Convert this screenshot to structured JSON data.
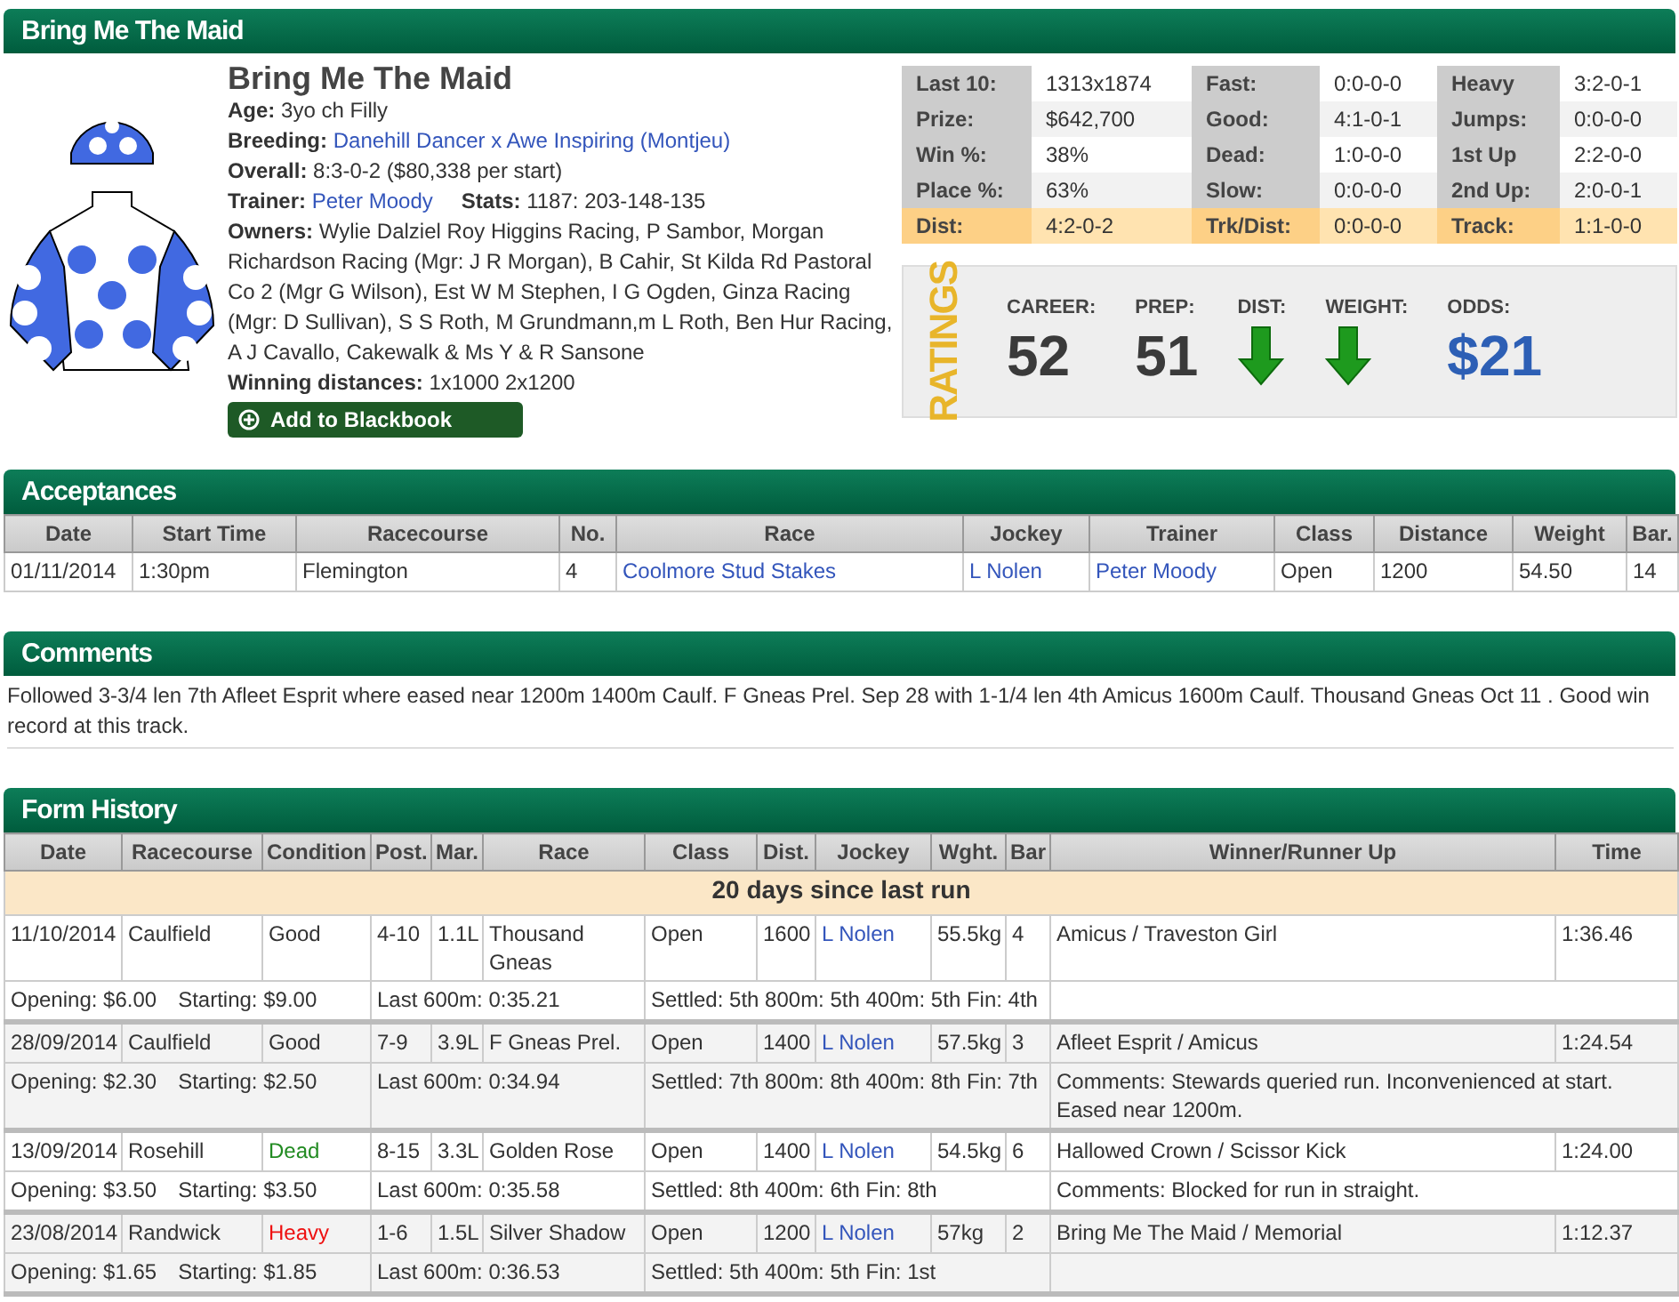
{
  "profile": {
    "header": "Bring Me The Maid",
    "name": "Bring Me The Maid",
    "lines": [
      {
        "parts": [
          {
            "label": "Age:",
            "value": "3yo ch Filly",
            "link": false
          }
        ]
      },
      {
        "parts": [
          {
            "label": "Breeding:",
            "value": "Danehill Dancer x Awe Inspiring (Montjeu)",
            "link": true
          }
        ]
      },
      {
        "parts": [
          {
            "label": "Overall:",
            "value": "8:3-0-2 ($80,338 per start)",
            "link": false
          }
        ]
      },
      {
        "parts": [
          {
            "label": "Trainer:",
            "value": "Peter Moody",
            "link": true
          },
          {
            "label": "Stats:",
            "value": "1187: 203-148-135",
            "link": false
          }
        ]
      },
      {
        "parts": [
          {
            "label": "Owners:",
            "value": "Wylie Dalziel Roy Higgins Racing, P Sambor, Morgan Richardson Racing (Mgr: J R Morgan), B Cahir, St Kilda Rd Pastoral Co 2 (Mgr G Wilson), Est W M Stephen, I G Ogden, Ginza Racing (Mgr: D Sullivan), S S Roth, M Grundmann,m L Roth, Ben Hur Racing, A J Cavallo, Cakewalk & Ms Y & R Sansone",
            "link": false
          }
        ]
      },
      {
        "parts": [
          {
            "label": "Winning distances:",
            "value": "1x1000 2x1200",
            "link": false
          }
        ]
      }
    ],
    "button": "Add to Blackbook"
  },
  "stats": [
    {
      "highlighted": false,
      "cells": [
        "Last 10:",
        "1313x1874",
        "Fast:",
        "0:0-0-0",
        "Heavy",
        "3:2-0-1"
      ]
    },
    {
      "highlighted": false,
      "cells": [
        "Prize:",
        "$642,700",
        "Good:",
        "4:1-0-1",
        "Jumps:",
        "0:0-0-0"
      ]
    },
    {
      "highlighted": false,
      "cells": [
        "Win %:",
        "38%",
        "Dead:",
        "1:0-0-0",
        "1st Up",
        "2:2-0-0"
      ]
    },
    {
      "highlighted": false,
      "cells": [
        "Place %:",
        "63%",
        "Slow:",
        "0:0-0-0",
        "2nd Up:",
        "2:0-0-1"
      ]
    },
    {
      "highlighted": true,
      "cells": [
        "Dist:",
        "4:2-0-2",
        "Trk/Dist:",
        "0:0-0-0",
        "Track:",
        "1:1-0-0"
      ]
    }
  ],
  "ratings": {
    "title": "RATINGS",
    "items": [
      {
        "kind": "number",
        "label": "CAREER:",
        "value": "52"
      },
      {
        "kind": "number",
        "label": "PREP:",
        "value": "51"
      },
      {
        "kind": "arrow",
        "label": "DIST:",
        "down": true
      },
      {
        "kind": "arrow",
        "label": "WEIGHT:",
        "down": true
      },
      {
        "kind": "odds",
        "label": "ODDS:",
        "value": "$21"
      }
    ]
  },
  "acceptances": {
    "title": "Acceptances",
    "columns": [
      "Date",
      "Start Time",
      "Racecourse",
      "No.",
      "Race",
      "Jockey",
      "Trainer",
      "Class",
      "Distance",
      "Weight",
      "Bar."
    ],
    "rows": [
      {
        "date": "01/11/2014",
        "start_time": "1:30pm",
        "racecourse": "Flemington",
        "no": "4",
        "race": "Coolmore Stud Stakes",
        "jockey": "L Nolen",
        "trainer": "Peter Moody",
        "class": "Open",
        "distance": "1200",
        "weight": "54.50",
        "bar": "14"
      }
    ]
  },
  "comments": {
    "title": "Comments",
    "text": "Followed 3-3/4 len 7th Afleet Esprit where eased near 1200m 1400m Caulf. F Gneas Prel. Sep 28 with 1-1/4 len 4th Amicus 1600m Caulf. Thousand Gneas Oct 11 . Good win record at this track."
  },
  "form_history": {
    "title": "Form History",
    "columns": [
      "Date",
      "Racecourse",
      "Condition",
      "Post.",
      "Mar.",
      "Race",
      "Class",
      "Dist.",
      "Jockey",
      "Wght.",
      "Bar",
      "Winner/Runner Up",
      "Time"
    ],
    "banner": "20 days since last run",
    "runs": [
      {
        "date": "11/10/2014",
        "racecourse": "Caulfield",
        "condition": "Good",
        "color": "#333333",
        "post": "4-10",
        "margin": "1.1L",
        "race": "Thousand Gneas",
        "class": "Open",
        "dist": "1600",
        "jockey": "L Nolen",
        "weight": "55.5kg",
        "bar": "4",
        "placegetters": "Amicus / Traveston Girl",
        "time": "1:36.46",
        "opening": "Opening: $6.00",
        "starting": "Starting: $9.00",
        "last_600m": "Last 600m: 0:35.21",
        "settled": "Settled: 5th 800m: 5th 400m: 5th Fin: 4th"
      },
      {
        "date": "28/09/2014",
        "racecourse": "Caulfield",
        "condition": "Good",
        "color": "#333333",
        "post": "7-9",
        "margin": "3.9L",
        "race": "F Gneas Prel.",
        "class": "Open",
        "dist": "1400",
        "jockey": "L Nolen",
        "weight": "57.5kg",
        "bar": "3",
        "placegetters": "Afleet Esprit / Amicus",
        "time": "1:24.54",
        "opening": "Opening: $2.30",
        "starting": "Starting: $2.50",
        "last_600m": "Last 600m: 0:34.94",
        "settled": "Settled: 7th 800m: 8th 400m: 8th Fin: 7th",
        "comments": "Comments: Stewards queried run. Inconvenienced at start. Eased near 1200m."
      },
      {
        "date": "13/09/2014",
        "racecourse": "Rosehill",
        "condition": "Dead",
        "color": "#228b22",
        "post": "8-15",
        "margin": "3.3L",
        "race": "Golden Rose",
        "class": "Open",
        "dist": "1400",
        "jockey": "L Nolen",
        "weight": "54.5kg",
        "bar": "6",
        "placegetters": "Hallowed Crown / Scissor Kick",
        "time": "1:24.00",
        "opening": "Opening: $3.50",
        "starting": "Starting: $3.50",
        "last_600m": "Last 600m: 0:35.58",
        "settled": "Settled: 8th 400m: 6th Fin: 8th",
        "comments": "Comments: Blocked for run in straight."
      },
      {
        "date": "23/08/2014",
        "racecourse": "Randwick",
        "condition": "Heavy",
        "color": "#ee1111",
        "post": "1-6",
        "margin": "1.5L",
        "race": "Silver Shadow",
        "class": "Open",
        "dist": "1200",
        "jockey": "L Nolen",
        "weight": "57kg",
        "bar": "2",
        "placegetters": "Bring Me The Maid / Memorial",
        "time": "1:12.37",
        "opening": "Opening: $1.65",
        "starting": "Starting: $1.85",
        "last_600m": "Last 600m: 0:36.53",
        "settled": "Settled: 5th 400m: 5th Fin: 1st"
      }
    ]
  }
}
